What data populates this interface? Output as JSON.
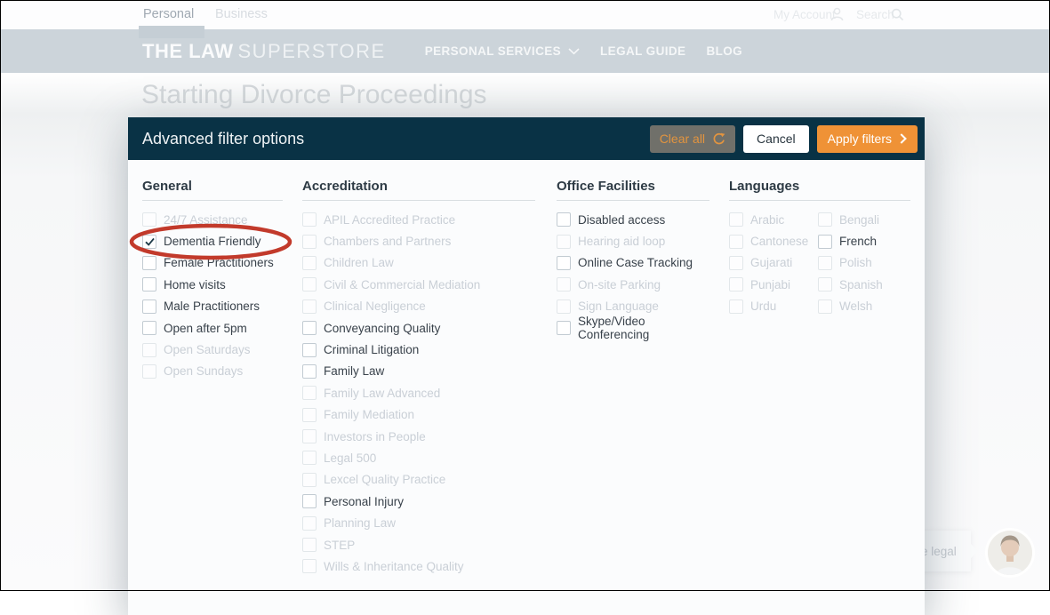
{
  "browser_top": {
    "tabs": [
      {
        "label": "Personal",
        "active": true
      },
      {
        "label": "Business",
        "active": false
      }
    ],
    "account_label": "My Account",
    "search_label": "Search"
  },
  "header": {
    "logo_bold": "THE LAW",
    "logo_light": "SUPERSTORE",
    "nav": [
      {
        "label": "PERSONAL SERVICES",
        "has_dropdown": true
      },
      {
        "label": "LEGAL GUIDE",
        "has_dropdown": false
      },
      {
        "label": "BLOG",
        "has_dropdown": false
      }
    ]
  },
  "page": {
    "title": "Starting Divorce Proceedings"
  },
  "modal": {
    "title": "Advanced filter options",
    "buttons": {
      "clear": "Clear all",
      "cancel": "Cancel",
      "apply": "Apply filters"
    },
    "columns": [
      {
        "heading": "General",
        "groups": [
          [
            {
              "label": "24/7 Assistance",
              "disabled": true,
              "checked": false
            },
            {
              "label": "Dementia Friendly",
              "disabled": false,
              "checked": true,
              "annotated": true
            },
            {
              "label": "Female Practitioners",
              "disabled": false,
              "checked": false
            },
            {
              "label": "Home visits",
              "disabled": false,
              "checked": false
            },
            {
              "label": "Male Practitioners",
              "disabled": false,
              "checked": false
            },
            {
              "label": "Open after 5pm",
              "disabled": false,
              "checked": false
            },
            {
              "label": "Open Saturdays",
              "disabled": true,
              "checked": false
            },
            {
              "label": "Open Sundays",
              "disabled": true,
              "checked": false
            }
          ]
        ]
      },
      {
        "heading": "Accreditation",
        "groups": [
          [
            {
              "label": "APIL Accredited Practice",
              "disabled": true,
              "checked": false
            },
            {
              "label": "Chambers and Partners",
              "disabled": true,
              "checked": false
            },
            {
              "label": "Children Law",
              "disabled": true,
              "checked": false
            },
            {
              "label": "Civil & Commercial Mediation",
              "disabled": true,
              "checked": false
            },
            {
              "label": "Clinical Negligence",
              "disabled": true,
              "checked": false
            },
            {
              "label": "Conveyancing Quality",
              "disabled": false,
              "checked": false
            },
            {
              "label": "Criminal Litigation",
              "disabled": false,
              "checked": false
            },
            {
              "label": "Family Law",
              "disabled": false,
              "checked": false
            },
            {
              "label": "Family Law Advanced",
              "disabled": true,
              "checked": false
            },
            {
              "label": "Family Mediation",
              "disabled": true,
              "checked": false
            },
            {
              "label": "Investors in People",
              "disabled": true,
              "checked": false
            },
            {
              "label": "Legal 500",
              "disabled": true,
              "checked": false
            },
            {
              "label": "Lexcel Quality Practice",
              "disabled": true,
              "checked": false
            },
            {
              "label": "Personal Injury",
              "disabled": false,
              "checked": false
            },
            {
              "label": "Planning Law",
              "disabled": true,
              "checked": false
            },
            {
              "label": "STEP",
              "disabled": true,
              "checked": false
            },
            {
              "label": "Wills & Inheritance Quality",
              "disabled": true,
              "checked": false
            }
          ]
        ]
      },
      {
        "heading": "Office Facilities",
        "groups": [
          [
            {
              "label": "Disabled access",
              "disabled": false,
              "checked": false
            },
            {
              "label": "Hearing aid loop",
              "disabled": true,
              "checked": false
            },
            {
              "label": "Online Case Tracking",
              "disabled": false,
              "checked": false
            },
            {
              "label": "On-site Parking",
              "disabled": true,
              "checked": false
            },
            {
              "label": "Sign Language",
              "disabled": true,
              "checked": false
            },
            {
              "label": "Skype/Video Conferencing",
              "disabled": false,
              "checked": false
            }
          ]
        ]
      },
      {
        "heading": "Languages",
        "groups": [
          [
            {
              "label": "Arabic",
              "disabled": true,
              "checked": false
            },
            {
              "label": "Cantonese",
              "disabled": true,
              "checked": false
            },
            {
              "label": "Gujarati",
              "disabled": true,
              "checked": false
            },
            {
              "label": "Punjabi",
              "disabled": true,
              "checked": false
            },
            {
              "label": "Urdu",
              "disabled": true,
              "checked": false
            }
          ],
          [
            {
              "label": "Bengali",
              "disabled": true,
              "checked": false
            },
            {
              "label": "French",
              "disabled": false,
              "checked": false
            },
            {
              "label": "Polish",
              "disabled": true,
              "checked": false
            },
            {
              "label": "Spanish",
              "disabled": true,
              "checked": false
            },
            {
              "label": "Welsh",
              "disabled": true,
              "checked": false
            }
          ]
        ]
      }
    ]
  },
  "chat": {
    "bubble_text": "e legal"
  },
  "icons": {
    "refresh": "clockwise-refresh-arrow",
    "chevron_down": "chevron-down",
    "chevron_right": "chevron-right",
    "person": "person-outline",
    "search": "magnifier",
    "checkmark": "check"
  },
  "colors": {
    "accent_orange": "#EF9236",
    "modal_header": "#093245",
    "annotation_red": "#C23A2B",
    "clear_button_bg": "#70706A",
    "header_band_dimmed": "#CCD4DA",
    "disabled_text": "#C9CFD6",
    "enabled_text": "#39424B"
  }
}
